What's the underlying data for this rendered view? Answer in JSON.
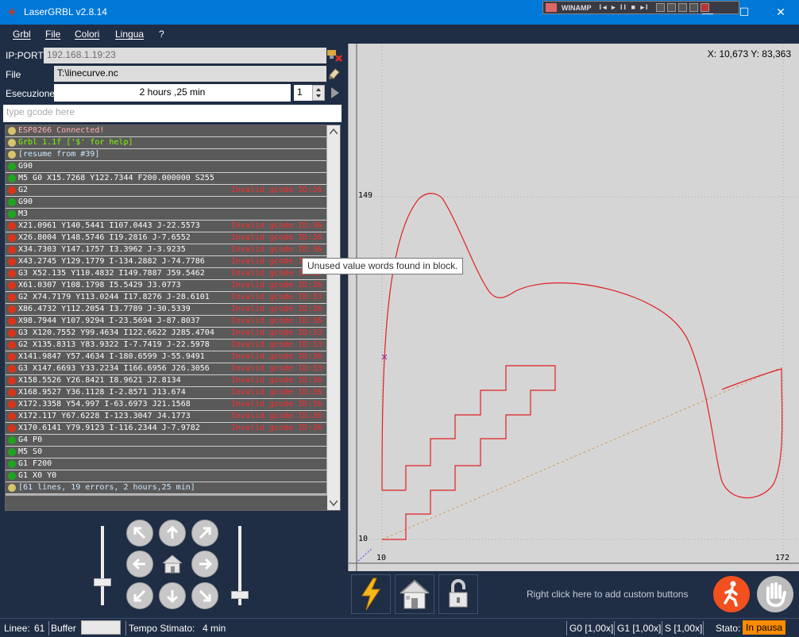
{
  "window": {
    "title": "LaserGRBL v2.8.14",
    "minimize": "—",
    "maximize": "☐",
    "close": "✕"
  },
  "winamp": {
    "label": "WINAMP",
    "controls": "I◂ ▸ II ■ ▸I"
  },
  "menu": [
    "Grbl",
    "File",
    "Colori",
    "Lingua",
    "?"
  ],
  "connection": {
    "ip_label": "IP:PORT",
    "ip_value": "192.168.1.19:23",
    "file_label": "File",
    "file_value": "T:\\linecurve.nc",
    "exec_label": "Esecuzione",
    "exec_value": "2 hours ,25 min",
    "repeat_value": "1",
    "gcode_placeholder": "type gcode here"
  },
  "log": [
    {
      "icon": "info",
      "text": "ESP8266 Connected!",
      "error": "",
      "color": "#ffb0b0"
    },
    {
      "icon": "info",
      "text": "Grbl 1.1f ['$' for help]",
      "error": "",
      "color": "#7cfc00"
    },
    {
      "icon": "info",
      "text": "[resume from #39]",
      "error": "",
      "color": "#cfe8ff"
    },
    {
      "icon": "ok",
      "text": "G90",
      "error": "",
      "color": "#ffffff"
    },
    {
      "icon": "ok",
      "text": "M5 G0 X15.7268 Y122.7344 F200.000000 S255",
      "error": "",
      "color": "#ffffff"
    },
    {
      "icon": "err",
      "text": "G2",
      "error": "Invalid gcode ID:26",
      "color": "#ffffff"
    },
    {
      "icon": "ok",
      "text": "G90",
      "error": "",
      "color": "#ffffff"
    },
    {
      "icon": "ok",
      "text": "M3",
      "error": "",
      "color": "#ffffff"
    },
    {
      "icon": "err",
      "text": "X21.0961 Y140.5441 I107.0443 J-22.5573",
      "error": "Invalid gcode ID:36",
      "color": "#ffffff"
    },
    {
      "icon": "err",
      "text": "X26.8004 Y148.5746 I19.2816 J-7.6552",
      "error": "Invalid gcode ID:36",
      "color": "#ffffff"
    },
    {
      "icon": "err",
      "text": "X34.7303 Y147.1757 I3.3962 J-3.9235",
      "error": "Invalid gcode ID:36",
      "color": "#ffffff"
    },
    {
      "icon": "err",
      "text": "X43.2745 Y129.1779 I-134.2882 J-74.7786",
      "error": "Invalid gcode ID:36",
      "color": "#ffffff"
    },
    {
      "icon": "err",
      "text": "G3 X52.135 Y110.4832 I149.7887 J59.5462",
      "error": "Invalid gcode ID:33",
      "color": "#ffffff"
    },
    {
      "icon": "err",
      "text": "X61.0307 Y108.1798 I5.5429 J3.0773",
      "error": "Invalid gcode ID:36",
      "color": "#ffffff"
    },
    {
      "icon": "err",
      "text": "G2 X74.7179 Y113.0244 I17.8276 J-28.6101",
      "error": "Invalid gcode ID:33",
      "color": "#ffffff"
    },
    {
      "icon": "err",
      "text": "X86.4732 Y112.2054 I3.7789 J-30.5339",
      "error": "Invalid gcode ID:36",
      "color": "#ffffff"
    },
    {
      "icon": "err",
      "text": "X98.7944 Y107.9294 I-23.5694 J-87.8037",
      "error": "Invalid gcode ID:36",
      "color": "#ffffff"
    },
    {
      "icon": "err",
      "text": "G3 X120.7552 Y99.4634 I122.6622 J285.4704",
      "error": "Invalid gcode ID:33",
      "color": "#ffffff"
    },
    {
      "icon": "err",
      "text": "G2 X135.8313 Y83.9322 I-7.7419 J-22.5978",
      "error": "Invalid gcode ID:33",
      "color": "#ffffff"
    },
    {
      "icon": "err",
      "text": "X141.9847 Y57.4634 I-180.6599 J-55.9491",
      "error": "Invalid gcode ID:36",
      "color": "#ffffff"
    },
    {
      "icon": "err",
      "text": "G3 X147.6693 Y33.2234 I166.6956 J26.3056",
      "error": "Invalid gcode ID:33",
      "color": "#ffffff"
    },
    {
      "icon": "err",
      "text": "X158.5526 Y26.8421 I8.9621 J2.8134",
      "error": "Invalid gcode ID:36",
      "color": "#ffffff"
    },
    {
      "icon": "err",
      "text": "X168.9527 Y36.1128 I-2.8571 J13.674",
      "error": "Invalid gcode ID:36",
      "color": "#ffffff"
    },
    {
      "icon": "err",
      "text": "X172.3358 Y54.997 I-63.6973 J21.1568",
      "error": "Invalid gcode ID:36",
      "color": "#ffffff"
    },
    {
      "icon": "err",
      "text": "X172.117 Y67.6228 I-123.3047 J4.1773",
      "error": "Invalid gcode ID:36",
      "color": "#ffffff"
    },
    {
      "icon": "err",
      "text": "X170.6141 Y79.9123 I-116.2344 J-7.9782",
      "error": "Invalid gcode ID:36",
      "color": "#ffffff"
    },
    {
      "icon": "ok",
      "text": "G4 P0",
      "error": "",
      "color": "#ffffff"
    },
    {
      "icon": "ok",
      "text": "M5 S0",
      "error": "",
      "color": "#ffffff"
    },
    {
      "icon": "ok",
      "text": "G1 F200",
      "error": "",
      "color": "#ffffff"
    },
    {
      "icon": "ok",
      "text": "G1 X0 Y0",
      "error": "",
      "color": "#ffffff"
    },
    {
      "icon": "info",
      "text": "[61 lines, 19 errors, 2 hours,25 min]",
      "error": "",
      "color": "#cfe8ff"
    }
  ],
  "tooltip": "Unused value words found in block.",
  "preview": {
    "coords": "X: 10,673 Y: 83,363",
    "y_top": "149",
    "y_bottom": "10",
    "x_left": "10",
    "x_right": "172"
  },
  "toolbar": {
    "custom_hint": "Right click here to add custom buttons"
  },
  "status": {
    "lines_label": "Linee:",
    "lines_value": "61",
    "buffer_label": "Buffer",
    "time_label": "Tempo Stimato:",
    "time_value": "4 min",
    "g0": "G0 [1,00x]",
    "g1": "G1 [1,00x]",
    "s": "S [1,00x]",
    "state_label": "Stato:",
    "state_value": "In pausa"
  },
  "colors": {
    "accent": "#0078d7",
    "panel": "#1f2d45",
    "error_text": "#ff2a2a",
    "ok_icon": "#1ea51e",
    "err_icon": "#d9341a",
    "info_icon": "#d8c46a",
    "paused": "#ff8c00",
    "path": "#e02020"
  }
}
